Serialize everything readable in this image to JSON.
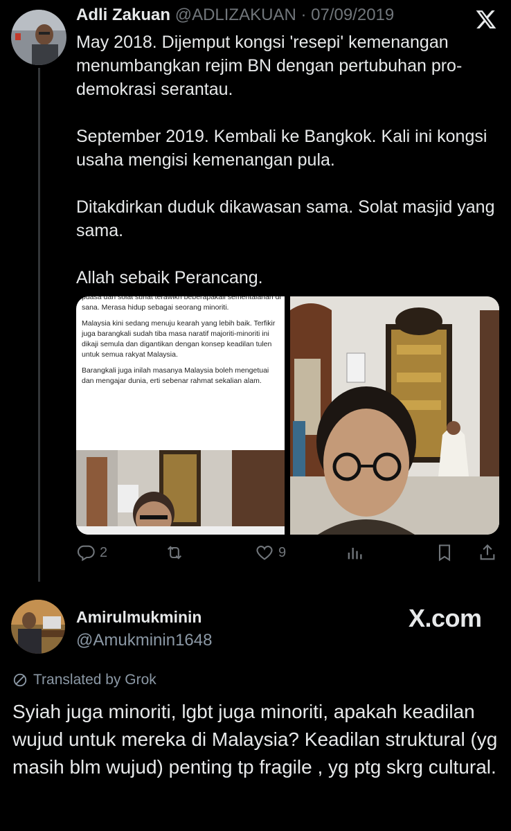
{
  "tweet": {
    "author_name": "Adli Zakuan",
    "author_handle": "@ADLIZAKUAN",
    "separator": "·",
    "date": "07/09/2019",
    "text": "May 2018. Dijemput kongsi 'resepi' kemenangan menumbangkan rejim BN dengan pertubuhan pro-demokrasi serantau.\n\nSeptember 2019. Kembali ke Bangkok. Kali ini kongsi usaha mengisi kemenangan pula.\n\nDitakdirkan duduk dikawasan sama. Solat masjid yang sama.\n\nAllah sebaik Perancang.",
    "media_article": {
      "paragraphs": [
        "puasa dan solat sunat terawikh beberapakali sementalahan di sana. Merasa hidup sebagai seorang minoriti.",
        "Malaysia kini sedang menuju kearah yang lebih baik. Terfikir juga barangkali sudah tiba masa naratif majoriti-minoriti ini dikaji semula dan digantikan dengan konsep keadilan tulen untuk semua rakyat Malaysia.",
        "Barangkali juga inilah masanya Malaysia boleh mengetuai dan mengajar dunia, erti sebenar rahmat sekalian alam."
      ]
    },
    "actions": {
      "replies": "2",
      "likes": "9"
    }
  },
  "reply": {
    "author_name": "Amirulmukminin",
    "author_handle": "@Amukminin1648",
    "watermark": "X.com",
    "translated_label": "Translated by Grok",
    "text": "Syiah juga minoriti, lgbt juga minoriti, apakah keadilan wujud untuk mereka di Malaysia? Keadilan struktural (yg masih blm wujud) penting tp fragile , yg ptg skrg cultural."
  },
  "icons": [
    "x-logo-icon",
    "reply-icon",
    "retweet-icon",
    "like-icon",
    "views-icon",
    "bookmark-icon",
    "share-icon",
    "grok-translate-icon"
  ],
  "colors": {
    "background": "#000000",
    "text": "#e7e9ea",
    "muted": "#71767b",
    "divider": "#333639"
  }
}
